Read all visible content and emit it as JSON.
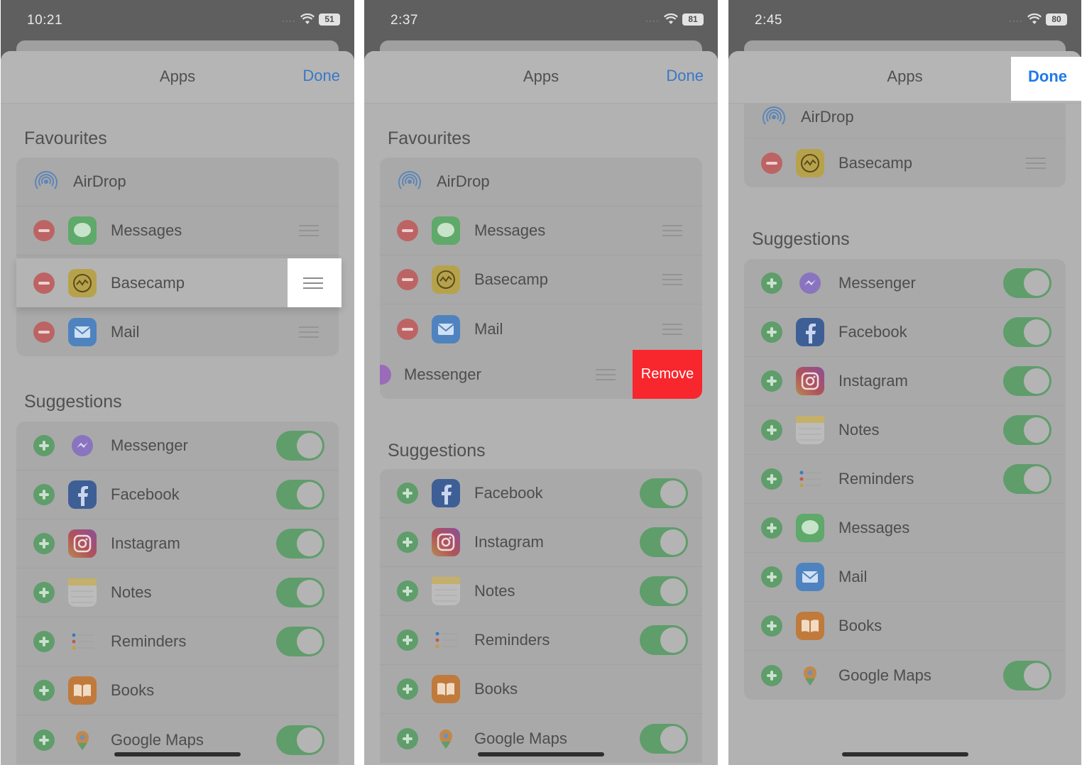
{
  "panels": [
    {
      "time": "10:21",
      "battery": "51",
      "nav": {
        "title": "Apps",
        "done": "Done"
      },
      "favourites_header": "Favourites",
      "suggestions_header": "Suggestions",
      "favourites": [
        "AirDrop",
        "Messages",
        "Basecamp",
        "Mail"
      ],
      "suggestions": [
        "Messenger",
        "Facebook",
        "Instagram",
        "Notes",
        "Reminders",
        "Books",
        "Google Maps"
      ]
    },
    {
      "time": "2:37",
      "battery": "81",
      "nav": {
        "title": "Apps",
        "done": "Done"
      },
      "favourites_header": "Favourites",
      "suggestions_header": "Suggestions",
      "favourites": [
        "AirDrop",
        "Messages",
        "Basecamp",
        "Mail"
      ],
      "swipe_row": {
        "label": "Messenger",
        "action": "Remove"
      },
      "suggestions": [
        "Facebook",
        "Instagram",
        "Notes",
        "Reminders",
        "Books",
        "Google Maps"
      ]
    },
    {
      "time": "2:45",
      "battery": "80",
      "nav": {
        "title": "Apps",
        "done": "Done"
      },
      "suggestions_header": "Suggestions",
      "favourites": [
        "AirDrop",
        "Basecamp"
      ],
      "suggestions": [
        "Messenger",
        "Facebook",
        "Instagram",
        "Notes",
        "Reminders",
        "Messages",
        "Mail",
        "Books",
        "Google Maps"
      ]
    }
  ],
  "colors": {
    "done_blue": "#1f7ae8",
    "remove_red": "#f8262d",
    "toggle_green": "#5f9d6b",
    "minus_red": "#bc6464"
  },
  "icons": {
    "airdrop": "airdrop-icon",
    "messages": "messages-icon",
    "basecamp": "basecamp-icon",
    "mail": "mail-icon",
    "messenger": "messenger-icon",
    "facebook": "facebook-icon",
    "instagram": "instagram-icon",
    "notes": "notes-icon",
    "reminders": "reminders-icon",
    "books": "books-icon",
    "google_maps": "google-maps-icon"
  }
}
